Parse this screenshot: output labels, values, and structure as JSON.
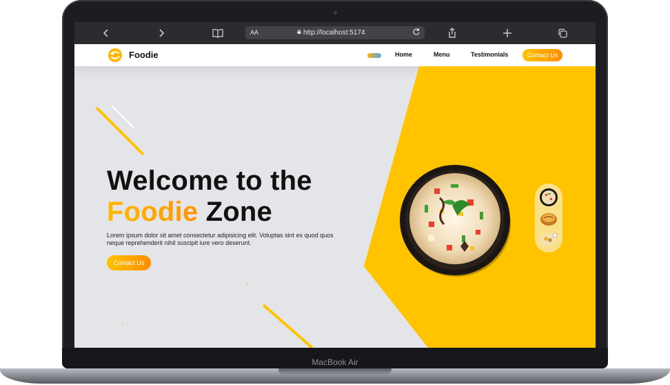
{
  "device": {
    "model": "MacBook Air"
  },
  "browser": {
    "text_size_label": "AA",
    "url": "http://localhost:5174",
    "icons": [
      "back-icon",
      "forward-icon",
      "reader-icon",
      "lock-icon",
      "reload-icon",
      "share-icon",
      "new-tab-icon",
      "tabs-icon"
    ]
  },
  "nav": {
    "logo_text": "Foodie",
    "links": [
      "Home",
      "Menu",
      "Testimonials"
    ],
    "cta": "Contact Us"
  },
  "hero": {
    "headline_line1": "Welcome to the",
    "headline_accent": "Foodie",
    "headline_rest": "Zone",
    "description": "Lorem ipsum dolor sit amet consectetur adipisicing elit. Voluptas sint ex quod quos neque reprehenderit nihil suscipit iure vero deserunt.",
    "cta": "Contact Us"
  },
  "dish_thumbnails": [
    "biryani-bowl-thumb",
    "noodle-plate-thumb",
    "salad-plate-thumb"
  ],
  "colors": {
    "accent_yellow": "#ffc300",
    "accent_orange": "#ff8c00",
    "hero_bg": "#e4e5e8",
    "browser_bar": "#2b2c30"
  }
}
